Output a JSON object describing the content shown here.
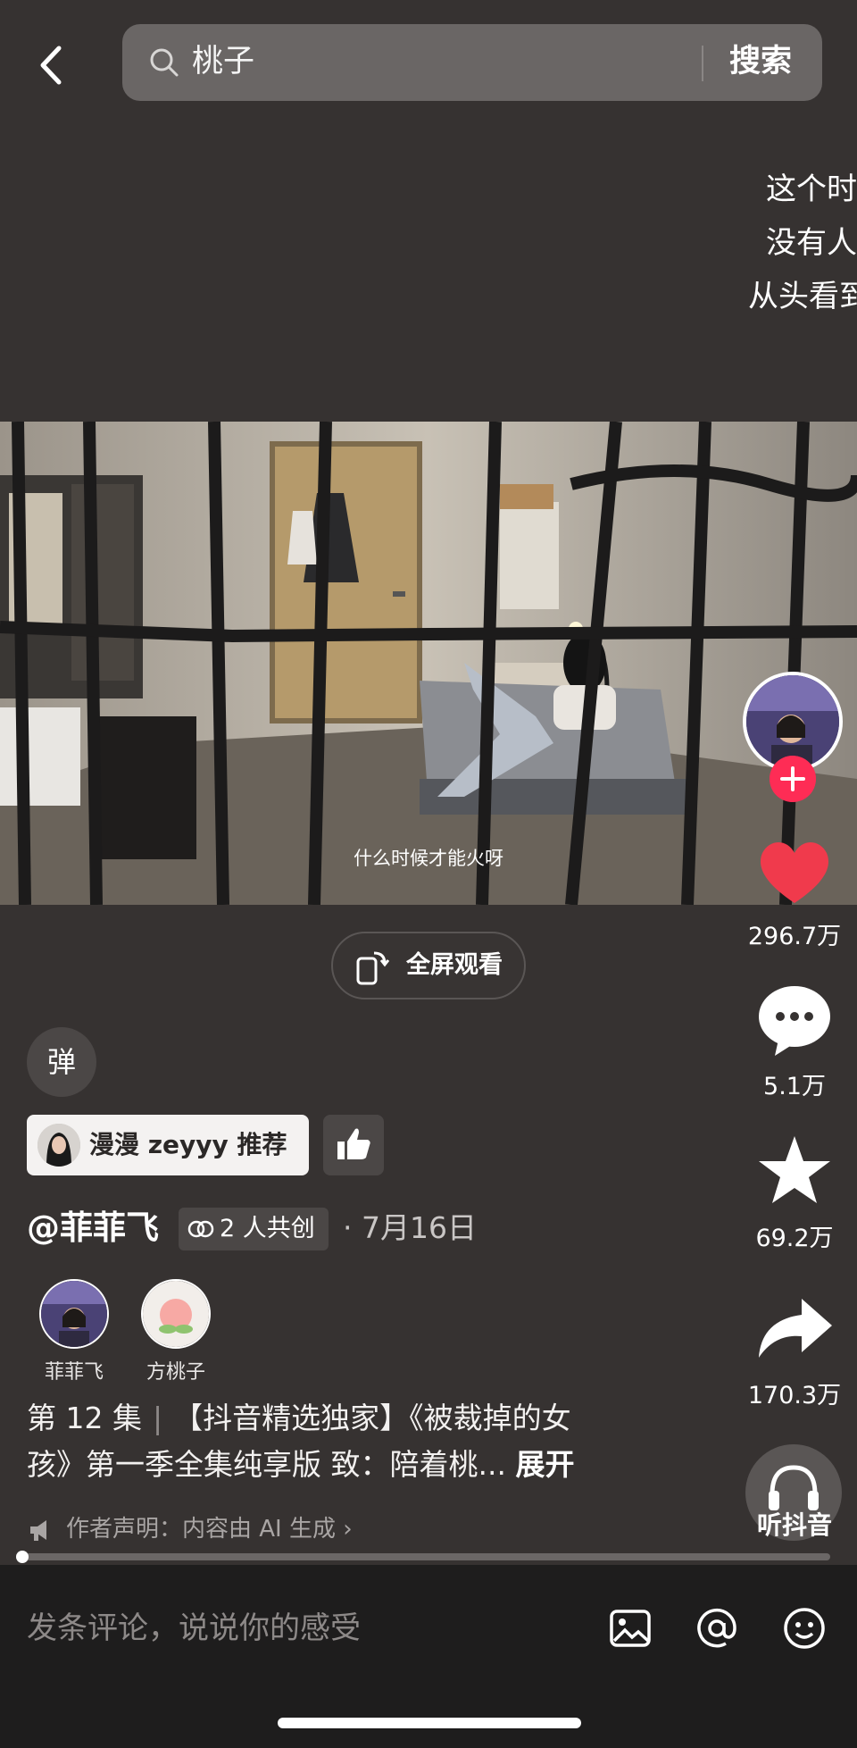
{
  "header": {
    "search_query": "桃子",
    "search_button": "搜索",
    "icons": {
      "back": "back-arrow-icon",
      "search": "search-icon"
    }
  },
  "background_text": [
    "这个时",
    "没有人",
    "从头看到"
  ],
  "video": {
    "subtitle": "什么时候才能火呀",
    "fullscreen_label": "全屏观看"
  },
  "rail": {
    "likes": "296.7万",
    "comments": "5.1万",
    "favorites": "69.2万",
    "shares": "170.3万",
    "listen_label": "听抖音",
    "icons": [
      "heart-icon",
      "comment-icon",
      "star-icon",
      "share-icon",
      "headphones-icon"
    ]
  },
  "info": {
    "danmu_label": "弹",
    "recommend_text": "漫漫 zeyyy 推荐",
    "author": "@菲菲飞",
    "cocreate_label": "2 人共创",
    "date": "· 7月16日",
    "members": [
      {
        "name": "菲菲飞"
      },
      {
        "name": "方桃子"
      }
    ],
    "episode": "第 12 集",
    "description_line1": "【抖音精选独家】《被裁掉的女",
    "description_line2": "孩》第一季全集纯享版 致：陪着桃...",
    "expand_label": "展开",
    "statement": "作者声明：内容由 AI 生成 ›",
    "progress": 0.0
  },
  "comment_bar": {
    "placeholder": "发条评论，说说你的感受",
    "icons": [
      "image-icon",
      "at-icon",
      "emoji-icon"
    ]
  },
  "colors": {
    "background": "#363231",
    "accent_red": "#fe2c55",
    "like_red": "#f03a4c",
    "comment_bar": "#1e1d1d"
  }
}
